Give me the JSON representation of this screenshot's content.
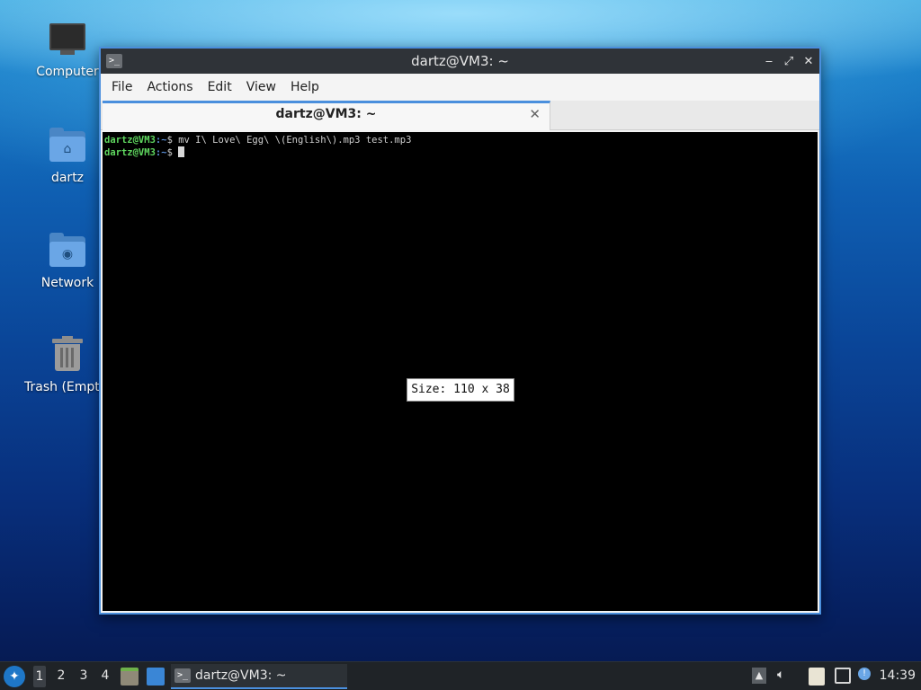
{
  "desktop": {
    "icons": [
      {
        "label": "Computer"
      },
      {
        "label": "dartz"
      },
      {
        "label": "Network"
      },
      {
        "label": "Trash (Empty)"
      }
    ]
  },
  "window": {
    "title": "dartz@VM3: ~",
    "controls": {
      "minimize": "‒",
      "maximize": "⤢",
      "close": "✕"
    },
    "menu": [
      "File",
      "Actions",
      "Edit",
      "View",
      "Help"
    ],
    "tab": {
      "title": "dartz@VM3: ~",
      "close": "✕"
    },
    "terminal": {
      "lines": [
        {
          "user": "dartz@VM3",
          "path": ":~",
          "symbol": "$ ",
          "command": "mv I\\ Love\\ Egg\\ \\(English\\).mp3 test.mp3"
        },
        {
          "user": "dartz@VM3",
          "path": ":~",
          "symbol": "$ ",
          "command": ""
        }
      ]
    },
    "size_tooltip": "Size: 110 x 38"
  },
  "taskbar": {
    "workspaces": [
      "1",
      "2",
      "3",
      "4"
    ],
    "active_workspace": "1",
    "task": {
      "label": "dartz@VM3: ~"
    },
    "clock": "14:39"
  },
  "colors": {
    "accent": "#4a8fdd",
    "prompt_user": "#5fd75f",
    "prompt_path": "#5b8fd6",
    "titlebar": "#2f3338",
    "taskbar": "#1f2327"
  }
}
